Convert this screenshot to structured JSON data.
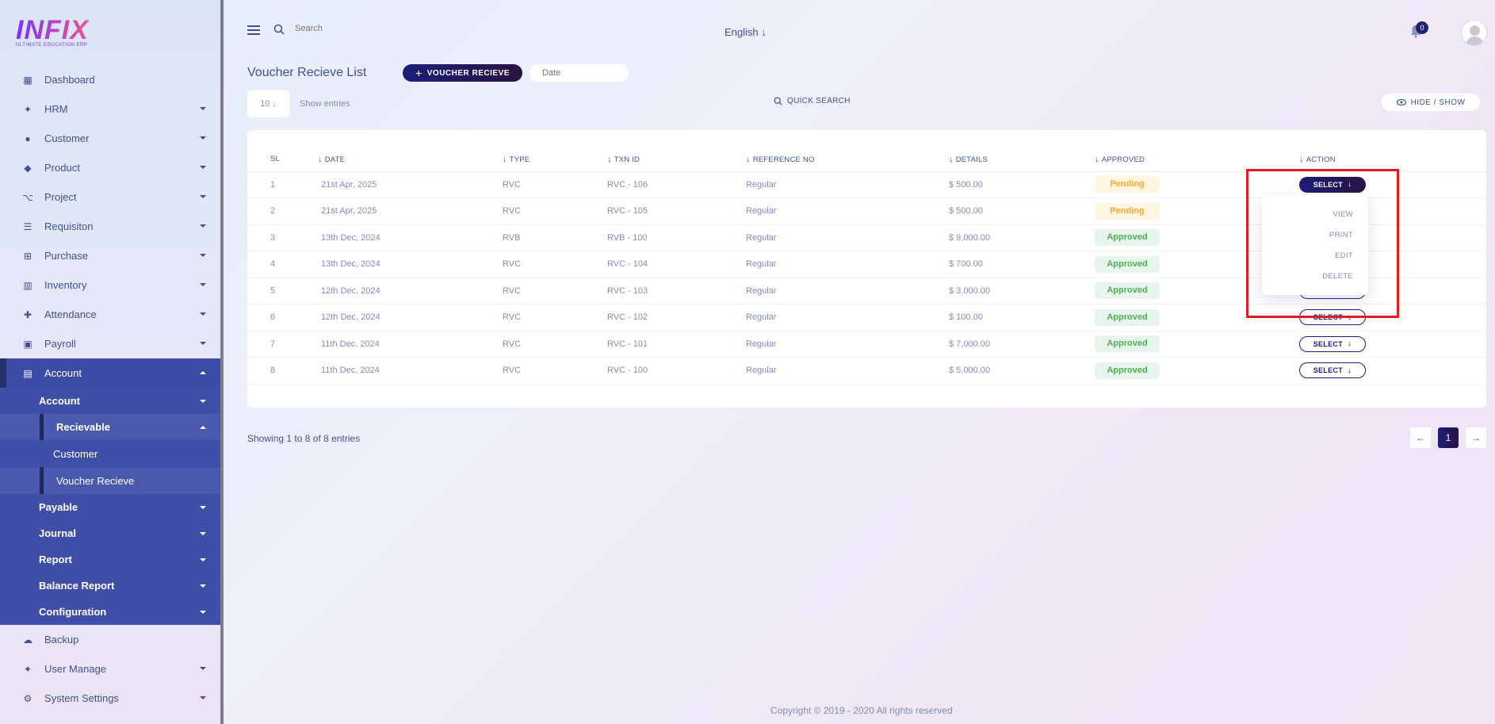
{
  "brand": {
    "logo_text": "INFIX",
    "tagline": "ULTIMATE EDUCATION ERP"
  },
  "sidebar": {
    "items": [
      {
        "label": "Dashboard",
        "icon": "grid-icon"
      },
      {
        "label": "HRM",
        "icon": "users-icon"
      },
      {
        "label": "Customer",
        "icon": "user-icon"
      },
      {
        "label": "Product",
        "icon": "tag-icon"
      },
      {
        "label": "Project",
        "icon": "project-icon"
      },
      {
        "label": "Requisiton",
        "icon": "list-icon"
      },
      {
        "label": "Purchase",
        "icon": "cart-icon"
      },
      {
        "label": "Inventory",
        "icon": "barcode-icon"
      },
      {
        "label": "Attendance",
        "icon": "user-plus-icon"
      },
      {
        "label": "Payroll",
        "icon": "money-icon"
      },
      {
        "label": "Account",
        "icon": "calculator-icon"
      }
    ],
    "account_sub": {
      "account": "Account",
      "recievable": "Recievable",
      "customer": "Customer",
      "voucher_recieve": "Voucher Recieve",
      "payable": "Payable",
      "journal": "Journal",
      "report": "Report",
      "balance_report": "Balance Report",
      "configuration": "Configuration"
    },
    "bottom_items": [
      {
        "label": "Backup",
        "icon": "cloud-icon"
      },
      {
        "label": "User Manage",
        "icon": "users-icon"
      },
      {
        "label": "System Settings",
        "icon": "gear-icon"
      }
    ]
  },
  "topbar": {
    "search_placeholder": "Search",
    "language": "English",
    "notification_count": "0"
  },
  "page": {
    "title": "Voucher Recieve List",
    "add_button": "VOUCHER RECIEVE",
    "date_placeholder": "Date",
    "entries_value": "10",
    "entries_label": "Show entries",
    "quick_search": "QUICK SEARCH",
    "hide_show": "HIDE / SHOW"
  },
  "table": {
    "headers": [
      "SL",
      "DATE",
      "TYPE",
      "TXN ID",
      "REFERENCE NO",
      "DETAILS",
      "APPROVED",
      "ACTION"
    ],
    "rows": [
      {
        "sl": "1",
        "date": "21st Apr, 2025",
        "type": "RVC",
        "txn": "RVC - 106",
        "ref": "Regular",
        "details": "$ 500.00",
        "status": "Pending"
      },
      {
        "sl": "2",
        "date": "21st Apr, 2025",
        "type": "RVC",
        "txn": "RVC - 105",
        "ref": "Regular",
        "details": "$ 500.00",
        "status": "Pending"
      },
      {
        "sl": "3",
        "date": "13th Dec, 2024",
        "type": "RVB",
        "txn": "RVB - 100",
        "ref": "Regular",
        "details": "$ 9,000.00",
        "status": "Approved"
      },
      {
        "sl": "4",
        "date": "13th Dec, 2024",
        "type": "RVC",
        "txn": "RVC - 104",
        "ref": "Regular",
        "details": "$ 700.00",
        "status": "Approved"
      },
      {
        "sl": "5",
        "date": "12th Dec, 2024",
        "type": "RVC",
        "txn": "RVC - 103",
        "ref": "Regular",
        "details": "$ 3,000.00",
        "status": "Approved"
      },
      {
        "sl": "6",
        "date": "12th Dec, 2024",
        "type": "RVC",
        "txn": "RVC - 102",
        "ref": "Regular",
        "details": "$ 100.00",
        "status": "Approved"
      },
      {
        "sl": "7",
        "date": "11th Dec, 2024",
        "type": "RVC",
        "txn": "RVC - 101",
        "ref": "Regular",
        "details": "$ 7,000.00",
        "status": "Approved"
      },
      {
        "sl": "8",
        "date": "11th Dec, 2024",
        "type": "RVC",
        "txn": "RVC - 100",
        "ref": "Regular",
        "details": "$ 5,000.00",
        "status": "Approved"
      }
    ],
    "select_label": "SELECT"
  },
  "dropdown": {
    "items": [
      "VIEW",
      "PRINT",
      "EDIT",
      "DELETE"
    ]
  },
  "pagination": {
    "summary": "Showing 1 to 8 of 8 entries",
    "current": "1"
  },
  "footer": {
    "copyright": "Copyright © 2019 - 2020 All rights reserved"
  },
  "colors": {
    "primary": "#415094",
    "accent": "#1b1f7a",
    "sidebar_active": "#3c4ba5",
    "highlight": "#e51b23",
    "pending": "#ffa726",
    "approved": "#4caf50"
  }
}
